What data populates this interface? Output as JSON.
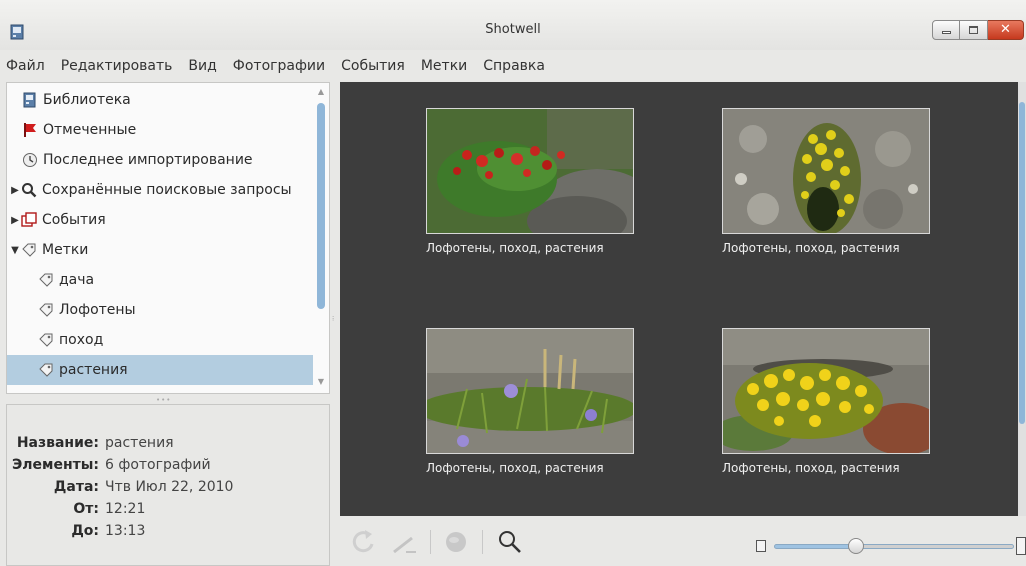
{
  "window": {
    "title": "Shotwell",
    "close_glyph": "✕"
  },
  "menu": [
    "Файл",
    "Редактировать",
    "Вид",
    "Фотографии",
    "События",
    "Метки",
    "Справка"
  ],
  "sidebar": {
    "items": [
      {
        "label": "Библиотека",
        "icon": "library-icon"
      },
      {
        "label": "Отмеченные",
        "icon": "flag-icon"
      },
      {
        "label": "Последнее импортирование",
        "icon": "clock-icon"
      },
      {
        "label": "Сохранённые поисковые запросы",
        "icon": "search-icon",
        "expander": "▶"
      },
      {
        "label": "События",
        "icon": "events-icon",
        "expander": "▶"
      },
      {
        "label": "Метки",
        "icon": "tag-icon",
        "expander": "▼"
      },
      {
        "label": "дача",
        "icon": "tag-icon"
      },
      {
        "label": "Лофотены",
        "icon": "tag-icon"
      },
      {
        "label": "поход",
        "icon": "tag-icon"
      },
      {
        "label": "растения",
        "icon": "tag-icon",
        "selected": true
      }
    ]
  },
  "info": {
    "name_label": "Название:",
    "name_value": "растения",
    "items_label": "Элементы:",
    "items_value": "6 фотографий",
    "date_label": "Дата:",
    "date_value": "Чтв Июл 22, 2010",
    "from_label": "От:",
    "from_value": "12:21",
    "to_label": "До:",
    "to_value": "13:13"
  },
  "photos": [
    {
      "caption": "Лофотены, поход, растения"
    },
    {
      "caption": "Лофотены, поход, растения"
    },
    {
      "caption": "Лофотены, поход, растения"
    },
    {
      "caption": "Лофотены, поход, растения"
    }
  ],
  "toolbar": {
    "zoom_level": 0.34
  },
  "colors": {
    "selected_row": "#b3cde0",
    "grid_background": "#3d3d3d",
    "accent": "#8fb6d8",
    "close_button": "#c6391e"
  }
}
